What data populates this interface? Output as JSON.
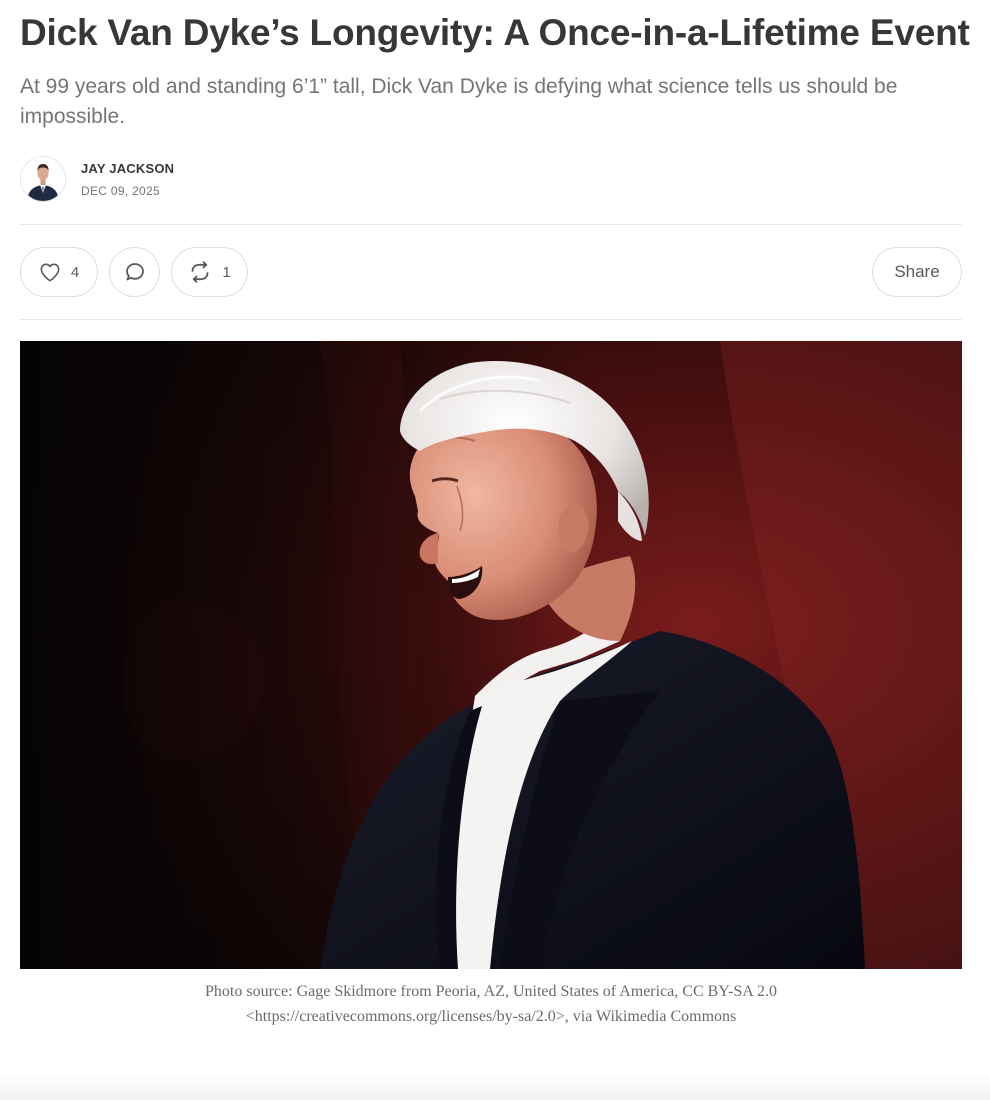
{
  "article": {
    "title": "Dick Van Dyke’s Longevity: A Once-in-a-Lifetime Event",
    "subtitle": "At 99 years old and standing 6’1” tall, Dick Van Dyke is defying what science tells us should be impossible."
  },
  "byline": {
    "author": "JAY JACKSON",
    "date": "DEC 09, 2025"
  },
  "actions": {
    "like_icon": "heart-icon",
    "like_count": "4",
    "comment_icon": "comment-bubble-icon",
    "restack_icon": "restack-arrows-icon",
    "restack_count": "1",
    "share_label": "Share"
  },
  "hero": {
    "caption": "Photo source: Gage Skidmore from Peoria, AZ, United States of America, CC BY-SA 2.0 <https://creativecommons.org/licenses/by-sa/2.0>, via Wikimedia Commons"
  },
  "colors": {
    "text": "#363737",
    "muted": "#757575",
    "border": "#dedede",
    "photo_background": "#5a1414"
  }
}
